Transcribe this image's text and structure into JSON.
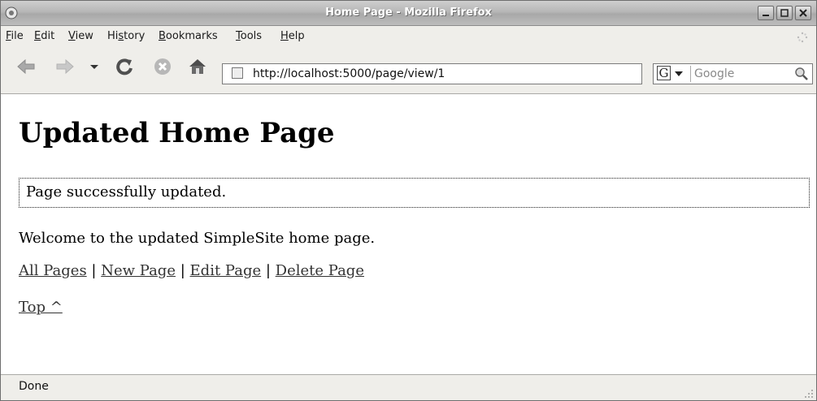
{
  "window": {
    "title": "Home Page - Mozilla Firefox"
  },
  "menu": [
    {
      "key": "F",
      "rest": "ile"
    },
    {
      "key": "E",
      "rest": "dit"
    },
    {
      "key": "V",
      "rest": "iew"
    },
    {
      "pre": "Hi",
      "key": "s",
      "rest": "tory"
    },
    {
      "key": "B",
      "rest": "ookmarks"
    },
    {
      "key": "T",
      "rest": "ools"
    },
    {
      "key": "H",
      "rest": "elp"
    }
  ],
  "url": {
    "value": "http://localhost:5000/page/view/1"
  },
  "search": {
    "placeholder": "Google",
    "engine_letter": "G"
  },
  "page": {
    "title": "Updated Home Page",
    "flash": "Page successfully updated.",
    "welcome": "Welcome to the updated SimpleSite home page.",
    "links": {
      "all_pages": "All Pages",
      "new_page": "New Page",
      "edit_page": "Edit Page",
      "delete_page": "Delete Page",
      "separator": "|"
    },
    "top_link": "Top ^"
  },
  "status": {
    "text": "Done"
  }
}
